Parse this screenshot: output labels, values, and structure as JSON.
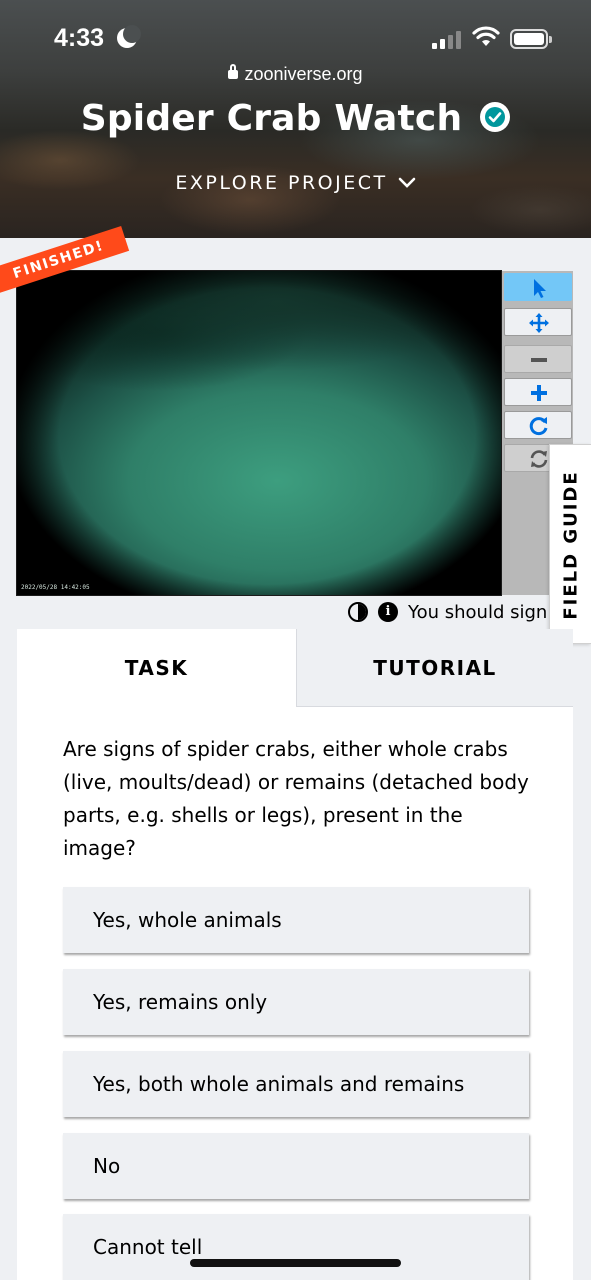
{
  "status_bar": {
    "time": "4:33",
    "url": "zooniverse.org"
  },
  "header": {
    "title": "Spider Crab Watch",
    "explore_label": "EXPLORE PROJECT"
  },
  "subject": {
    "status_ribbon": "FINISHED!",
    "timestamp": "2022/05/28 14:42:05"
  },
  "toolbar": {
    "tools": [
      "pointer-icon",
      "pan-icon",
      "zoom-out-icon",
      "zoom-in-icon",
      "rotate-icon",
      "reset-icon"
    ]
  },
  "field_guide_label": "FIELD GUIDE",
  "signin_note": "You should sign",
  "tabs": {
    "task": "TASK",
    "tutorial": "TUTORIAL"
  },
  "task": {
    "question": "Are signs of spider crabs, either whole crabs (live, moults/dead) or remains (detached body parts, e.g. shells or legs), present in the image?",
    "answers": [
      "Yes, whole animals",
      "Yes, remains only",
      "Yes, both whole animals and remains",
      "No",
      "Cannot tell"
    ]
  },
  "colors": {
    "accent_blue": "#0070e0",
    "ribbon_orange": "#ff4a1a",
    "active_tool": "#73c7f7",
    "verified_teal": "#00979d"
  }
}
